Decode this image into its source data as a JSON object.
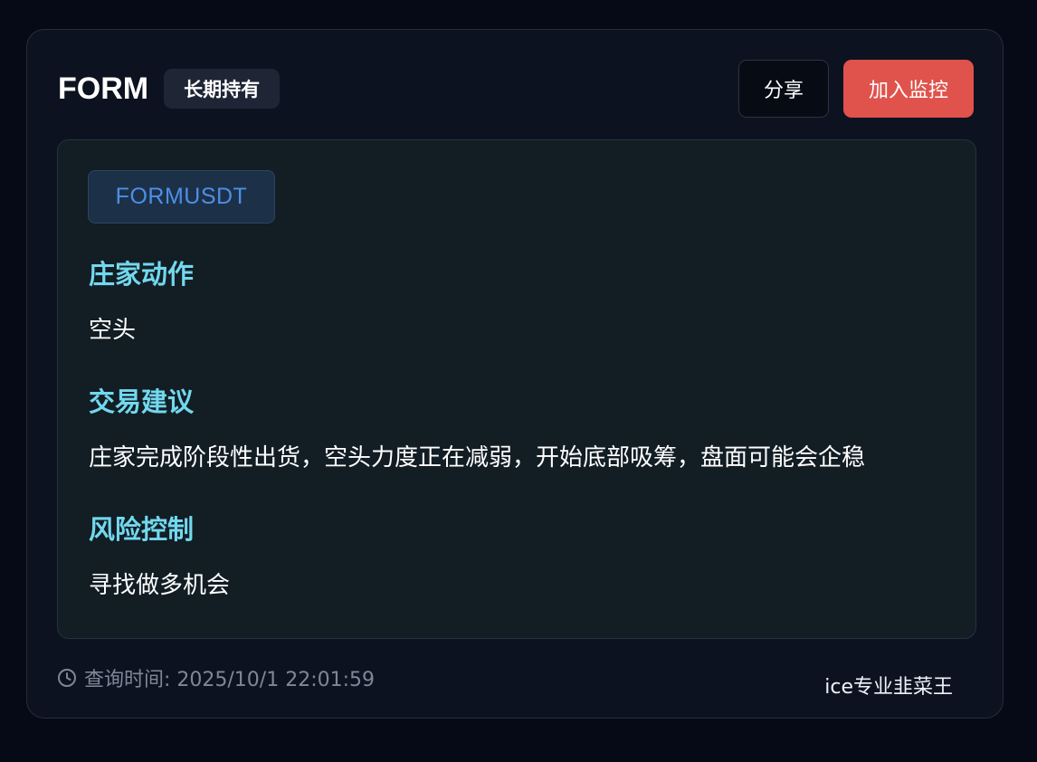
{
  "header": {
    "symbol": "FORM",
    "hold_badge": "长期持有",
    "share_label": "分享",
    "monitor_label": "加入监控"
  },
  "panel": {
    "pair": "FORMUSDT",
    "sections": [
      {
        "title": "庄家动作",
        "body": "空头"
      },
      {
        "title": "交易建议",
        "body": "庄家完成阶段性出货，空头力度正在减弱，开始底部吸筹，盘面可能会企稳"
      },
      {
        "title": "风险控制",
        "body": "寻找做多机会"
      }
    ]
  },
  "footer": {
    "query_time": "查询时间: 2025/10/1 22:01:59",
    "author": "ice专业韭菜王",
    "clock_icon": "clock-icon"
  },
  "colors": {
    "accent_red": "#e0524c",
    "section_title": "#72d8ee",
    "pair_text": "#4e8ee8"
  }
}
